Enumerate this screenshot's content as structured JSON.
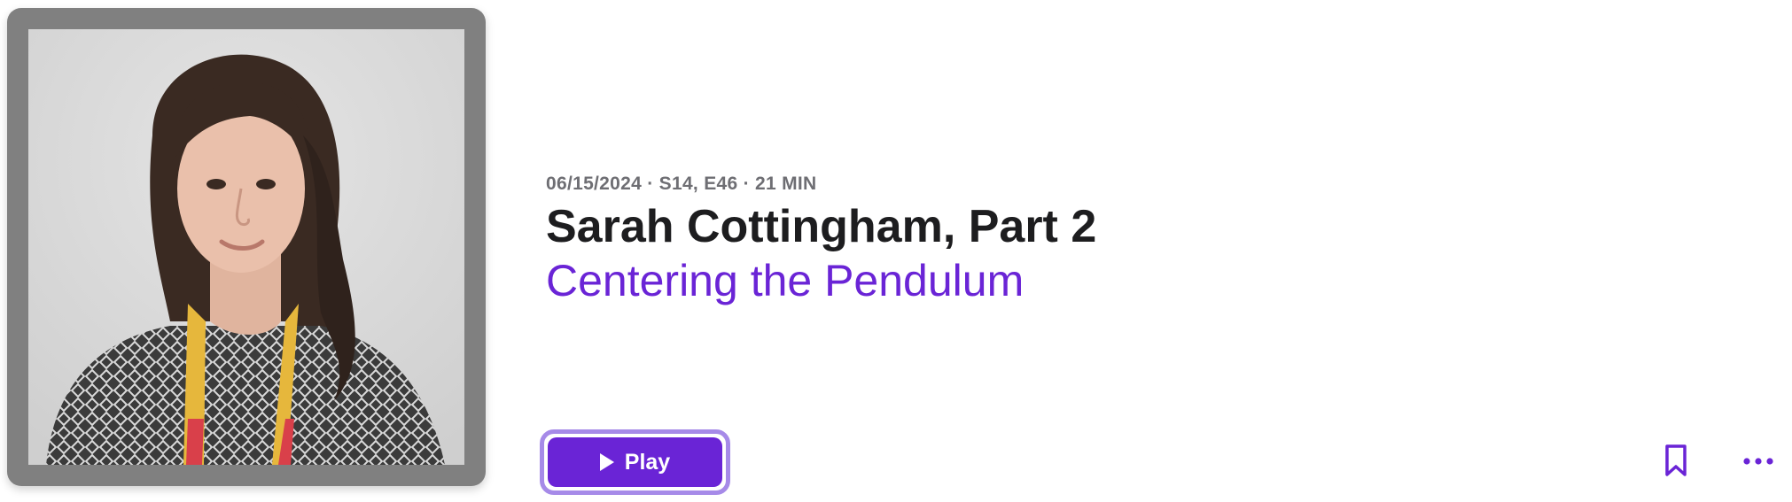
{
  "episode": {
    "meta": "06/15/2024 · S14, E46 · 21 MIN",
    "title": "Sarah Cottingham, Part 2",
    "show": "Centering the Pendulum"
  },
  "artwork": {
    "icon": "guest-portrait-photo"
  },
  "actions": {
    "play_label": "Play",
    "play_icon": "play-icon",
    "bookmark_icon": "bookmark-icon",
    "more_icon": "more-ellipsis-icon"
  },
  "colors": {
    "accent": "#6a24d6",
    "accent_ring": "#a68ae8",
    "title": "#1d1d1f",
    "meta": "#6e6e73",
    "artwork_frame": "#808080"
  }
}
